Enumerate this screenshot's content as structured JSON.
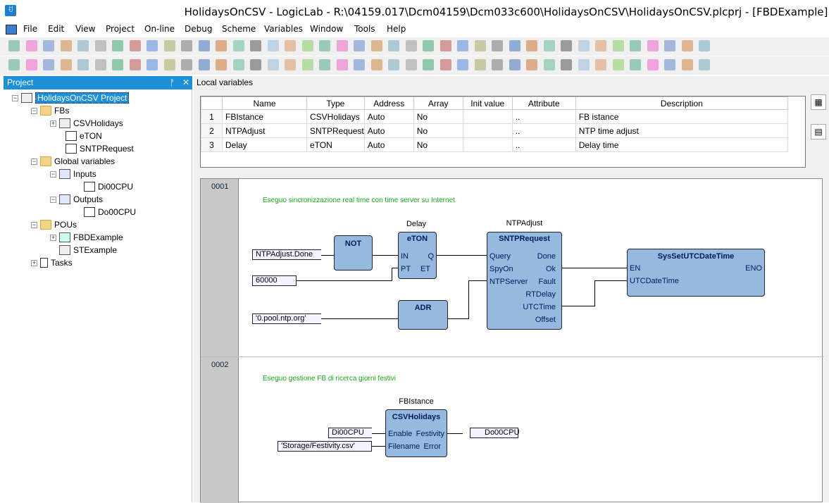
{
  "window": {
    "title": "HolidaysOnCSV - LogicLab - R:\\04159.017\\Dcm04159\\Dcm033c600\\HolidaysOnCSV\\HolidaysOnCSV.plcprj - [FBDExample]",
    "icon_glyph": "ꀀ"
  },
  "menu": [
    "File",
    "Edit",
    "View",
    "Project",
    "On-line",
    "Debug",
    "Scheme",
    "Variables",
    "Window",
    "Tools",
    "Help"
  ],
  "project_panel": {
    "title": "Project",
    "pin_glyph": "ᚡ",
    "close_glyph": "✕",
    "tree": [
      {
        "label": "HolidaysOnCSV Project",
        "selected": true
      },
      {
        "label": "FBs"
      },
      {
        "label": "CSVHolidays"
      },
      {
        "label": "eTON"
      },
      {
        "label": "SNTPRequest"
      },
      {
        "label": "Global variables"
      },
      {
        "label": "Inputs"
      },
      {
        "label": "Di00CPU"
      },
      {
        "label": "Outputs"
      },
      {
        "label": "Do00CPU"
      },
      {
        "label": "POUs"
      },
      {
        "label": "FBDExample"
      },
      {
        "label": "STExample"
      },
      {
        "label": "Tasks"
      }
    ]
  },
  "local_vars": {
    "header": "Local variables",
    "columns": [
      "",
      "Name",
      "Type",
      "Address",
      "Array",
      "Init value",
      "Attribute",
      "Description"
    ],
    "rows": [
      [
        "1",
        "FBIstance",
        "CSVHolidays",
        "Auto",
        "No",
        "",
        "..",
        "FB istance"
      ],
      [
        "2",
        "NTPAdjust",
        "SNTPRequest",
        "Auto",
        "No",
        "",
        "..",
        "NTP time adjust"
      ],
      [
        "3",
        "Delay",
        "eTON",
        "Auto",
        "No",
        "",
        "..",
        "Delay time"
      ]
    ]
  },
  "fbd": {
    "net1": {
      "num": "0001",
      "comment": "Eseguo sincronizzazione real time con time server su Internet",
      "inputs": {
        "done": "NTPAdjust.Done",
        "pt": "60000",
        "server": "'0.pool.ntp.org'"
      },
      "not": {
        "title": "NOT"
      },
      "eton": {
        "instance": "Delay",
        "title": "eTON",
        "pins": [
          "IN",
          "Q",
          "PT",
          "ET"
        ]
      },
      "adr": {
        "title": "ADR"
      },
      "sntp": {
        "instance": "NTPAdjust",
        "title": "SNTPRequest",
        "inputs": [
          "Query",
          "SpyOn",
          "NTPServer"
        ],
        "outputs": [
          "Done",
          "Ok",
          "Fault",
          "RTDelay",
          "UTCTime",
          "Offset"
        ]
      },
      "sys": {
        "title": "SysSetUTCDateTime",
        "inputs": [
          "EN",
          "UTCDateTime"
        ],
        "output": "ENO"
      }
    },
    "net2": {
      "num": "0002",
      "comment": "Eseguo gestione FB di ricerca giorni festivi",
      "csv": {
        "instance": "FBIstance",
        "title": "CSVHolidays",
        "inputs": [
          "Enable",
          "Filename"
        ],
        "outputs": [
          "Festivity",
          "Error"
        ]
      },
      "in_var": "Di00CPU",
      "file_var": "'Storage/Festivity.csv'",
      "out_var": "Do00CPU"
    }
  }
}
